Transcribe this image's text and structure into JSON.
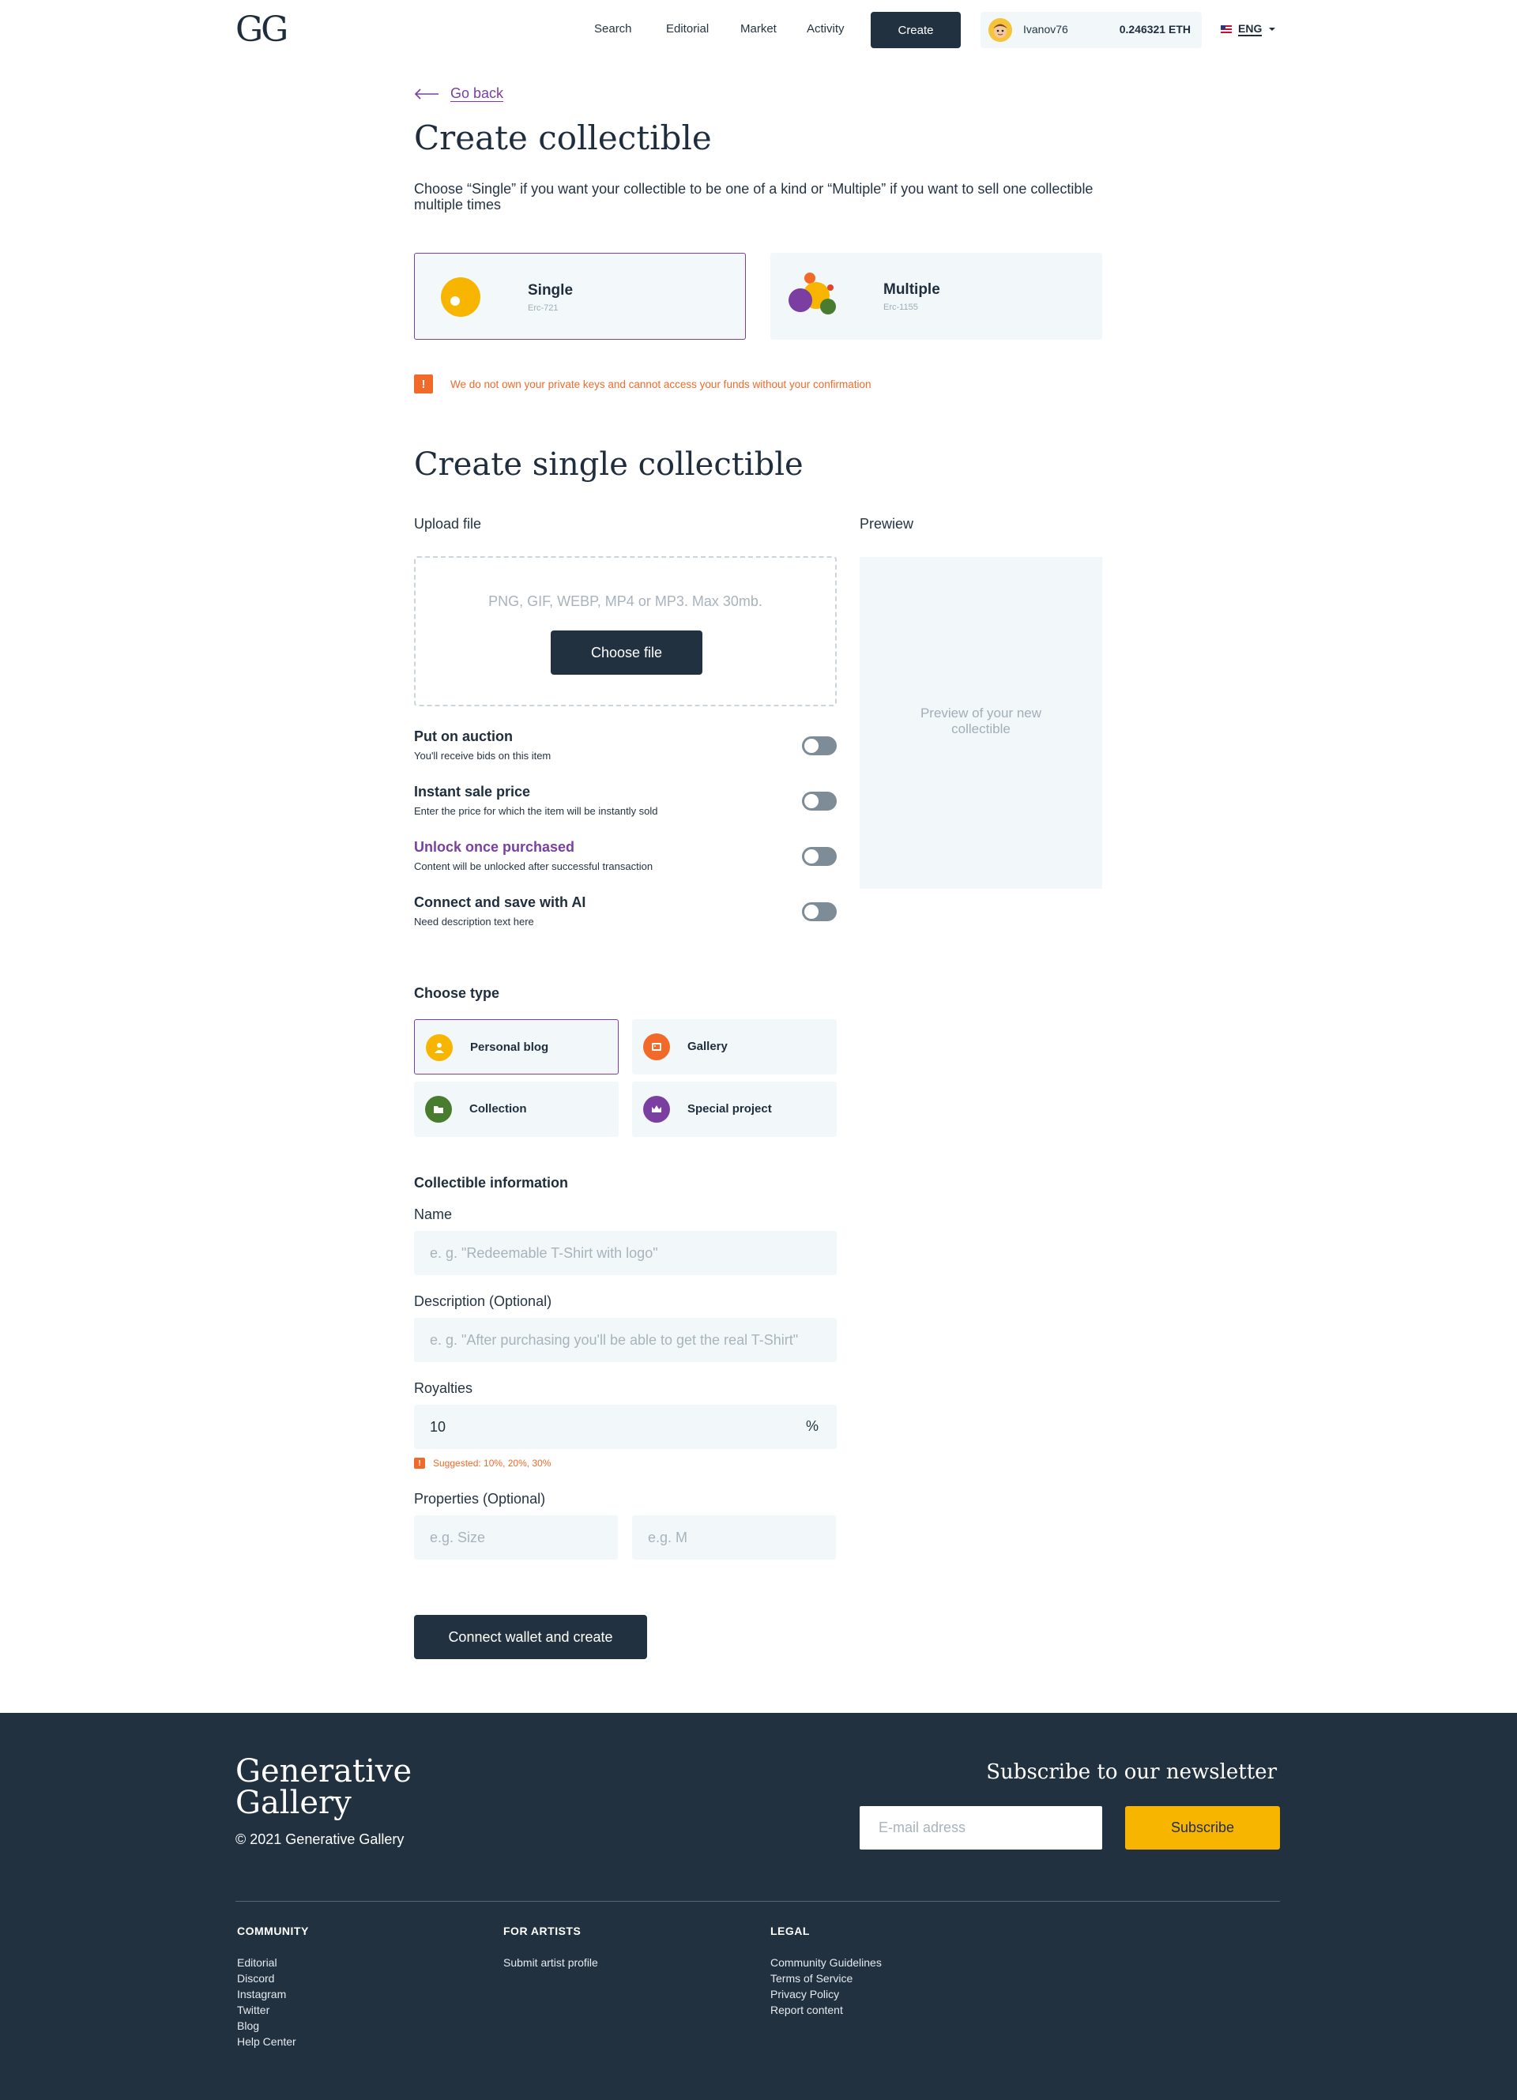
{
  "header": {
    "logo": "GG",
    "nav": [
      "Search",
      "Editorial",
      "Market",
      "Activity"
    ],
    "create_label": "Create",
    "wallet": {
      "username": "Ivanov76",
      "balance": "0.246321 ETH"
    },
    "language": "ENG"
  },
  "page": {
    "go_back": "Go back",
    "title": "Create collectible",
    "intro": "Choose “Single” if you want your collectible to be one of a kind or “Multiple” if you want to sell one collectible multiple times",
    "kinds": [
      {
        "name": "Single",
        "sub": "Erc-721",
        "selected": true
      },
      {
        "name": "Multiple",
        "sub": "Erc-1155",
        "selected": false
      }
    ],
    "warning": "We do not own your private keys and cannot access your funds without your confirmation",
    "section_title": "Create single collectible",
    "upload_label": "Upload file",
    "upload_hint": "PNG, GIF, WEBP, MP4 or MP3. Max 30mb.",
    "choose_file": "Choose file",
    "preview_label": "Prewiew",
    "preview_text": "Preview of your new collectible",
    "toggles": [
      {
        "title": "Put on auction",
        "desc": "You'll receive bids on this item",
        "on": false
      },
      {
        "title": "Instant sale price",
        "desc": "Enter the price for which the item will be instantly sold",
        "on": false
      },
      {
        "title": "Unlock once purchased",
        "desc": "Content will be unlocked after successful transaction",
        "on": false
      },
      {
        "title": "Connect and save with AI",
        "desc": "Need description text here",
        "on": false
      }
    ],
    "choose_type": "Choose type",
    "types": [
      {
        "name": "Personal blog",
        "icon": "person-icon",
        "color": "#f7b500",
        "selected": true
      },
      {
        "name": "Gallery",
        "icon": "gallery-icon",
        "color": "#f26a2a",
        "selected": false
      },
      {
        "name": "Collection",
        "icon": "folder-icon",
        "color": "#4a7c2f",
        "selected": false
      },
      {
        "name": "Special project",
        "icon": "crown-icon",
        "color": "#7a3fa0",
        "selected": false
      }
    ],
    "info_title": "Collectible information",
    "name_label": "Name",
    "name_placeholder": "e. g. \"Redeemable T-Shirt with logo\"",
    "desc_label": "Description (Optional)",
    "desc_placeholder": "e. g. \"After purchasing you'll be able to get the real T-Shirt\"",
    "royalties_label": "Royalties",
    "royalties_value": "10",
    "royalties_unit": "%",
    "royalties_hint": "Suggested: 10%, 20%, 30%",
    "properties_label": "Properties (Optional)",
    "prop_key_placeholder": "e.g. Size",
    "prop_val_placeholder": "e.g. M",
    "submit": "Connect wallet and create"
  },
  "footer": {
    "logo_line1": "Generative",
    "logo_line2": "Gallery",
    "copyright": "©  2021 Generative Gallery",
    "newsletter_title": "Subscribe to our newsletter",
    "email_placeholder": "E-mail adress",
    "subscribe": "Subscribe",
    "columns": [
      {
        "title": "COMMUNITY",
        "links": [
          "Editorial",
          "Discord",
          "Instagram",
          "Twitter",
          "Blog",
          "Help Center"
        ]
      },
      {
        "title": "FOR ARTISTS",
        "links": [
          "Submit artist profile"
        ]
      },
      {
        "title": "LEGAL",
        "links": [
          "Community Guidelines",
          "Terms of Service",
          "Privacy Policy",
          "Report content"
        ]
      }
    ]
  },
  "colors": {
    "primary_dark": "#213140",
    "accent_purple": "#7a3fa0",
    "warning_orange": "#f26a2a",
    "yellow": "#f7b500",
    "light_bg": "#f2f8fa"
  }
}
